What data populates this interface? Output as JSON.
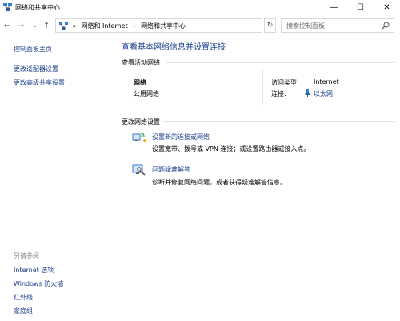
{
  "window": {
    "title": "网络和共享中心",
    "minimize_glyph": "—",
    "maximize_glyph": "☐",
    "close_glyph": "✕"
  },
  "address": {
    "back_glyph": "←",
    "forward_glyph": "→",
    "recent_glyph": "⌄",
    "up_glyph": "↑",
    "prefix": "«",
    "crumbs": [
      "网络和 Internet",
      "网络和共享中心"
    ],
    "separator": "›",
    "dropdown_glyph": "⌄",
    "refresh_glyph": "↻",
    "search_placeholder": "搜索控制面板"
  },
  "sidebar": {
    "home": "控制面板主页",
    "links": [
      "更改适配器设置",
      "更改高级共享设置"
    ],
    "see_also_title": "另请参阅",
    "see_also": [
      "Internet 选项",
      "Windows 防火墙",
      "红外线",
      "家庭组"
    ]
  },
  "main": {
    "title": "查看基本网络信息并设置连接",
    "active_networks_title": "查看活动网络",
    "network": {
      "name": "网络",
      "type": "公用网络",
      "access_type_label": "访问类型:",
      "access_type_value": "Internet",
      "connections_label": "连接:",
      "connection_link": "以太网"
    },
    "change_settings_title": "更改网络设置",
    "tasks": [
      {
        "link": "设置新的连接或网络",
        "description": "设置宽带、拨号或 VPN 连接；或设置路由器或接入点。",
        "icon": "new-connection-icon"
      },
      {
        "link": "问题疑难解答",
        "description": "诊断并修复网络问题，或者获得疑难解答信息。",
        "icon": "troubleshoot-icon"
      }
    ]
  },
  "colors": {
    "link": "#1a3e8c",
    "muted": "#8a8a8a",
    "divider": "#e3e3e3"
  }
}
